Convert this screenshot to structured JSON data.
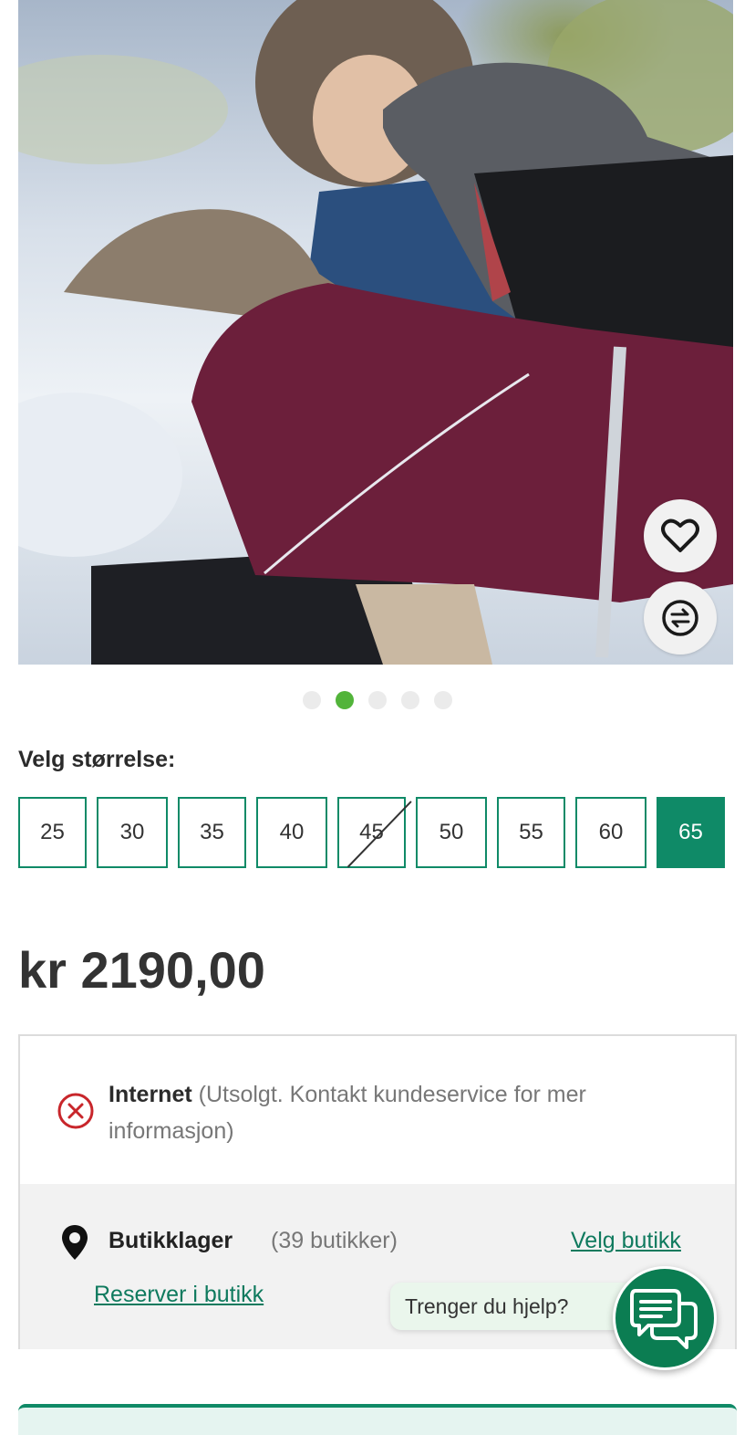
{
  "product": {
    "image_alt": "",
    "image_dots": [
      false,
      true,
      false,
      false,
      false
    ],
    "price": "kr 2190,00"
  },
  "actions": {
    "favorite_icon": "heart-icon",
    "compare_icon": "compare-arrows-icon"
  },
  "size_selector": {
    "label": "Velg størrelse:",
    "sizes": [
      {
        "label": "25",
        "available": true,
        "selected": false
      },
      {
        "label": "30",
        "available": true,
        "selected": false
      },
      {
        "label": "35",
        "available": true,
        "selected": false
      },
      {
        "label": "40",
        "available": true,
        "selected": false
      },
      {
        "label": "45",
        "available": false,
        "selected": false
      },
      {
        "label": "50",
        "available": true,
        "selected": false
      },
      {
        "label": "55",
        "available": true,
        "selected": false
      },
      {
        "label": "60",
        "available": true,
        "selected": false
      },
      {
        "label": "65",
        "available": true,
        "selected": true
      }
    ]
  },
  "availability": {
    "online": {
      "title": "Internet",
      "status": " (Utsolgt. Kontakt kundeservice for mer informasjon)",
      "icon": "x-circle-icon"
    },
    "store": {
      "title": "Butikklager",
      "count": "(39 butikker)",
      "choose_link": "Velg butikk",
      "reserve_link": "Reserver i butikk",
      "icon": "location-pin-icon"
    }
  },
  "help": {
    "bubble_text": "Trenger du hjelp?",
    "icon": "chat-icon"
  },
  "colors": {
    "accent": "#0f8a67",
    "active_dot": "#52b43a",
    "error": "#c8262b",
    "link": "#0f7a5e",
    "chat": "#0b7d52"
  }
}
